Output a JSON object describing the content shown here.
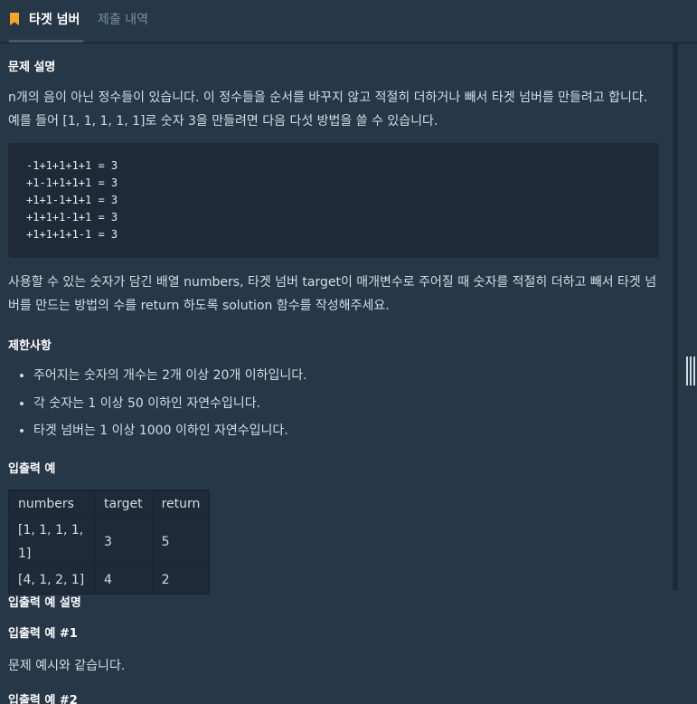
{
  "tabs": [
    {
      "label": "타겟 넘버",
      "active": true
    },
    {
      "label": "제출 내역",
      "active": false
    }
  ],
  "problem": {
    "heading": "문제 설명",
    "lines": [
      "n개의 음이 아닌 정수들이 있습니다. 이 정수들을 순서를 바꾸지 않고 적절히 더하거나 빼서 타겟 넘버를 만들려고 합니다.",
      "예를 들어 [1, 1, 1, 1, 1]로 숫자 3을 만들려면 다음 다섯 방법을 쓸 수 있습니다."
    ],
    "code": [
      "-1+1+1+1+1 = 3",
      "+1-1+1+1+1 = 3",
      "+1+1-1+1+1 = 3",
      "+1+1+1-1+1 = 3",
      "+1+1+1+1-1 = 3"
    ],
    "task_lines": [
      "사용할 수 있는 숫자가 담긴 배열 numbers, 타겟 넘버 target이 매개변수로 주어질 때 숫자를 적절히 더하고 빼서 타겟 넘",
      "버를 만드는 방법의 수를 return 하도록 solution 함수를 작성해주세요."
    ]
  },
  "constraints": {
    "heading": "제한사항",
    "items": [
      "주어지는 숫자의 개수는 2개 이상 20개 이하입니다.",
      "각 숫자는 1 이상 50 이하인 자연수입니다.",
      "타겟 넘버는 1 이상 1000 이하인 자연수입니다."
    ]
  },
  "examples": {
    "heading": "입출력 예",
    "columns": [
      "numbers",
      "target",
      "return"
    ],
    "rows": [
      [
        "[1, 1, 1, 1, 1]",
        "3",
        "5"
      ],
      [
        "[4, 1, 2, 1]",
        "4",
        "2"
      ]
    ]
  },
  "explanation": {
    "heading": "입출력 예 설명",
    "sub1": "입출력 예 #1",
    "text1": "문제 예시와 같습니다.",
    "sub2": "입출력 예 #2"
  },
  "colors": {
    "background": "#263747",
    "code_bg": "#1e2a38",
    "accent": "#f5a623"
  }
}
